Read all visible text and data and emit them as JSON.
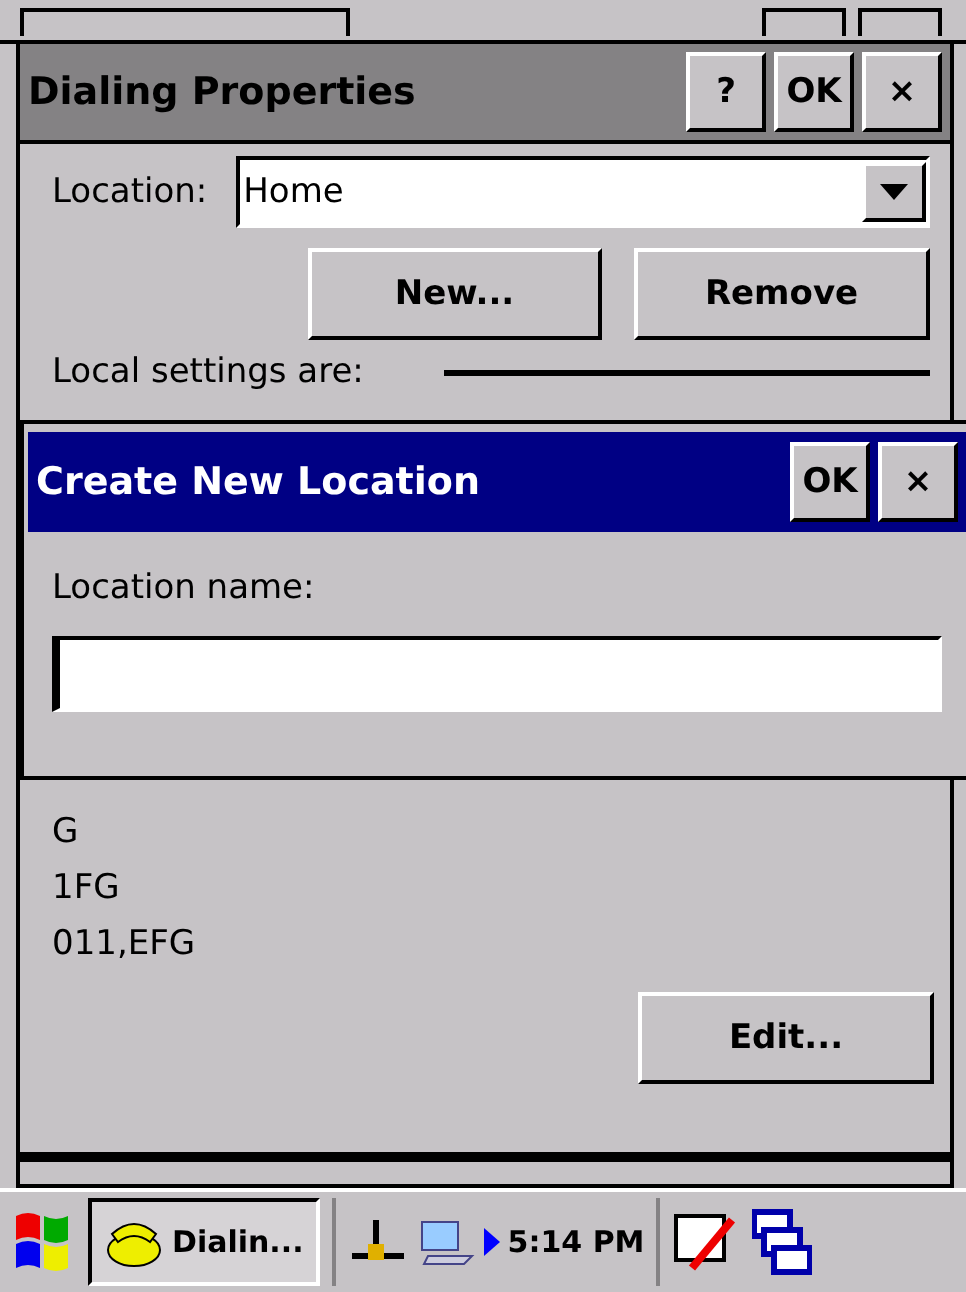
{
  "window": {
    "title": "Dialing Properties",
    "title_buttons": [
      "?",
      "OK",
      "×"
    ]
  },
  "location": {
    "label": "Location:",
    "value": "Home"
  },
  "buttons": [
    "New...",
    "Remove"
  ],
  "local_settings": {
    "label": "Local settings are:"
  },
  "dialing_patterns": {
    "lines": [
      "G",
      "1FG",
      "011,EFG"
    ]
  },
  "edit_button": "Edit...",
  "dialog": {
    "title": "Create New Location",
    "title_buttons": [
      "OK",
      "×"
    ],
    "field_label": "Location name:"
  },
  "taskbar": {
    "task": "Dialin...",
    "clock": "5:14 PM"
  }
}
